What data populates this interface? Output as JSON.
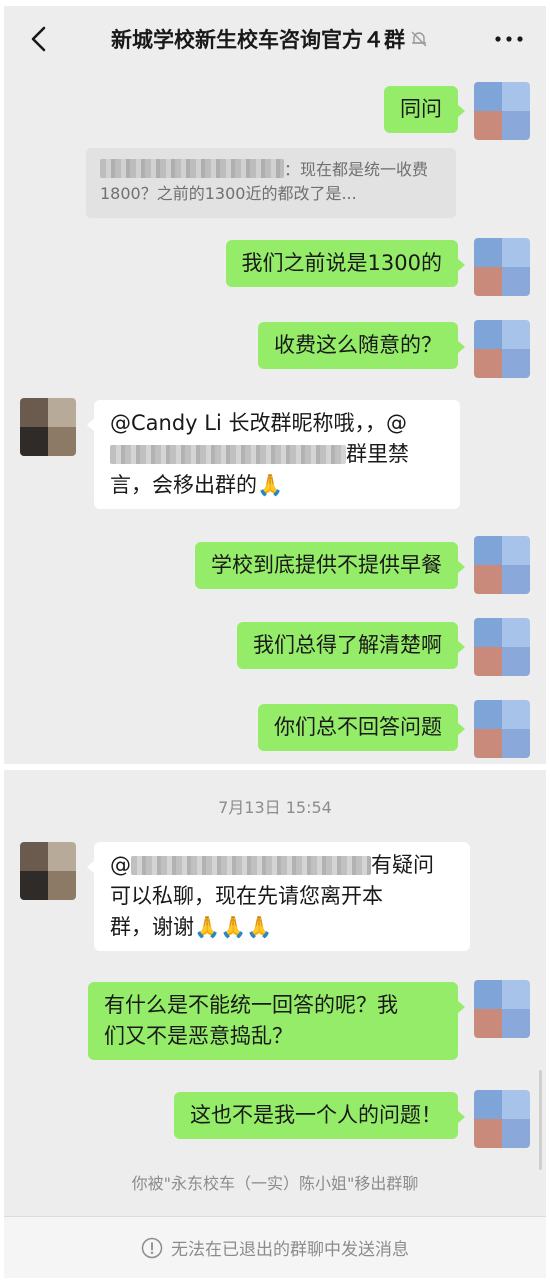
{
  "header": {
    "title": "新城学校新生校车咨询官方４群",
    "back_icon": "chevron-left-icon",
    "mute_icon": "bell-off-icon",
    "more_icon": "more-dots-icon"
  },
  "messages_top": [
    {
      "text": "同问"
    },
    {
      "quote_text": "：现在都是统一收费1800？之前的1300近的都改了是..."
    },
    {
      "text": "我们之前说是1300的"
    },
    {
      "text": "收费这么随意的？"
    },
    {
      "line1": "@Candy Li 长改群昵称哦，，@",
      "line2_suffix": "群里禁",
      "line3": "言，会移出群的🙏"
    },
    {
      "text": "学校到底提供不提供早餐"
    },
    {
      "text": "我们总得了解清楚啊"
    },
    {
      "text": "你们总不回答问题"
    }
  ],
  "timestamp": "7月13日 15:54",
  "messages_bottom": [
    {
      "line1_prefix": "@",
      "line1_suffix": "有疑问",
      "line2": "可以私聊，现在先请您离开本",
      "line3": "群，谢谢🙏🙏🙏"
    },
    {
      "line1": "有什么是不能统一回答的呢？我",
      "line2": "们又不是恶意捣乱？"
    },
    {
      "text": "这也不是我一个人的问题！"
    }
  ],
  "system_message": "你被\"永东校车（一实）陈小姐\"移出群聊",
  "footer": {
    "text": "无法在已退出的群聊中发送消息",
    "icon": "info-circle-icon"
  },
  "colors": {
    "chat_background": "#ededed",
    "own_bubble": "#95ec69",
    "other_bubble": "#ffffff",
    "system_text": "#8c8c8c"
  }
}
